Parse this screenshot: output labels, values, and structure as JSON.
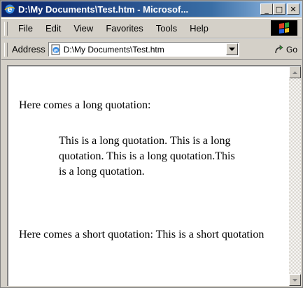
{
  "window": {
    "title": "D:\\My Documents\\Test.htm - Microsof...",
    "minimize_label": "_",
    "maximize_label": "□",
    "close_label": "✕"
  },
  "menu": {
    "items": [
      "File",
      "Edit",
      "View",
      "Favorites",
      "Tools",
      "Help"
    ]
  },
  "address": {
    "label": "Address",
    "value": "D:\\My Documents\\Test.htm",
    "go_label": "Go"
  },
  "page": {
    "intro": "Here comes a long quotation:",
    "blockquote": "This is a long quotation. This is a long quotation. This is a long quotation.This is a long quotation.",
    "short_quote": "Here comes a short quotation: This is a short quotation"
  },
  "colors": {
    "titlebar_start": "#0a246a",
    "titlebar_end": "#a6caf0",
    "chrome": "#d4d0c8",
    "page_bg": "#ffffff"
  },
  "icons": [
    "ie-app-icon",
    "windows-flag-icon",
    "html-page-icon",
    "go-arrow-icon",
    "dropdown-arrow-icon",
    "scroll-up-arrow-icon",
    "scroll-down-arrow-icon"
  ]
}
